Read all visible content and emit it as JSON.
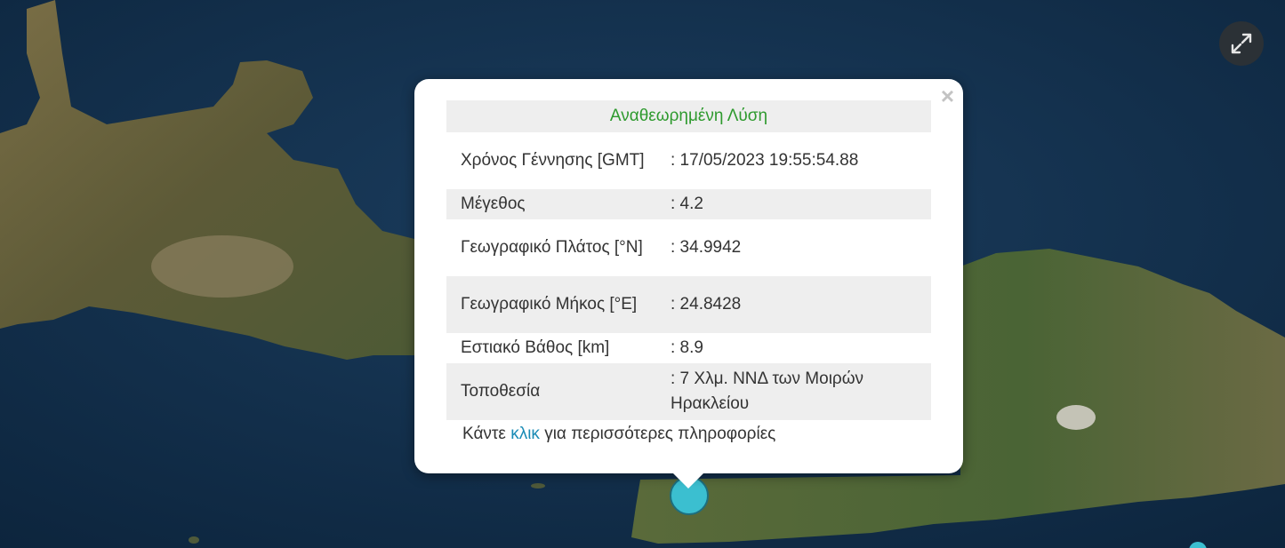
{
  "popup": {
    "header": "Αναθεωρημένη Λύση",
    "rows": [
      {
        "label": "Χρόνος Γέννησης [GMT]",
        "value": ": 17/05/2023 19:55:54.88"
      },
      {
        "label": "Μέγεθος",
        "value": ": 4.2"
      },
      {
        "label": "Γεωγραφικό Πλάτος [°N]",
        "value": ": 34.9942"
      },
      {
        "label": "Γεωγραφικό Μήκος [°E]",
        "value": ": 24.8428"
      },
      {
        "label": "Εστιακό Βάθος [km]",
        "value": ": 8.9"
      },
      {
        "label": "Τοποθεσία",
        "value": ": 7 Χλμ. ΝΝΔ των Μοιρών Ηρακλείου"
      }
    ],
    "footer_prefix": "Κάντε",
    "footer_link": "κλικ",
    "footer_suffix": "για περισσότερες πληροφορίες",
    "close_symbol": "×"
  },
  "map": {
    "sea_color": "#0f2a45",
    "land_color": "#6b6440",
    "marker_color": "#3bbfd0"
  },
  "icons": {
    "fullscreen": "expand-arrows-icon",
    "close": "close-icon"
  }
}
